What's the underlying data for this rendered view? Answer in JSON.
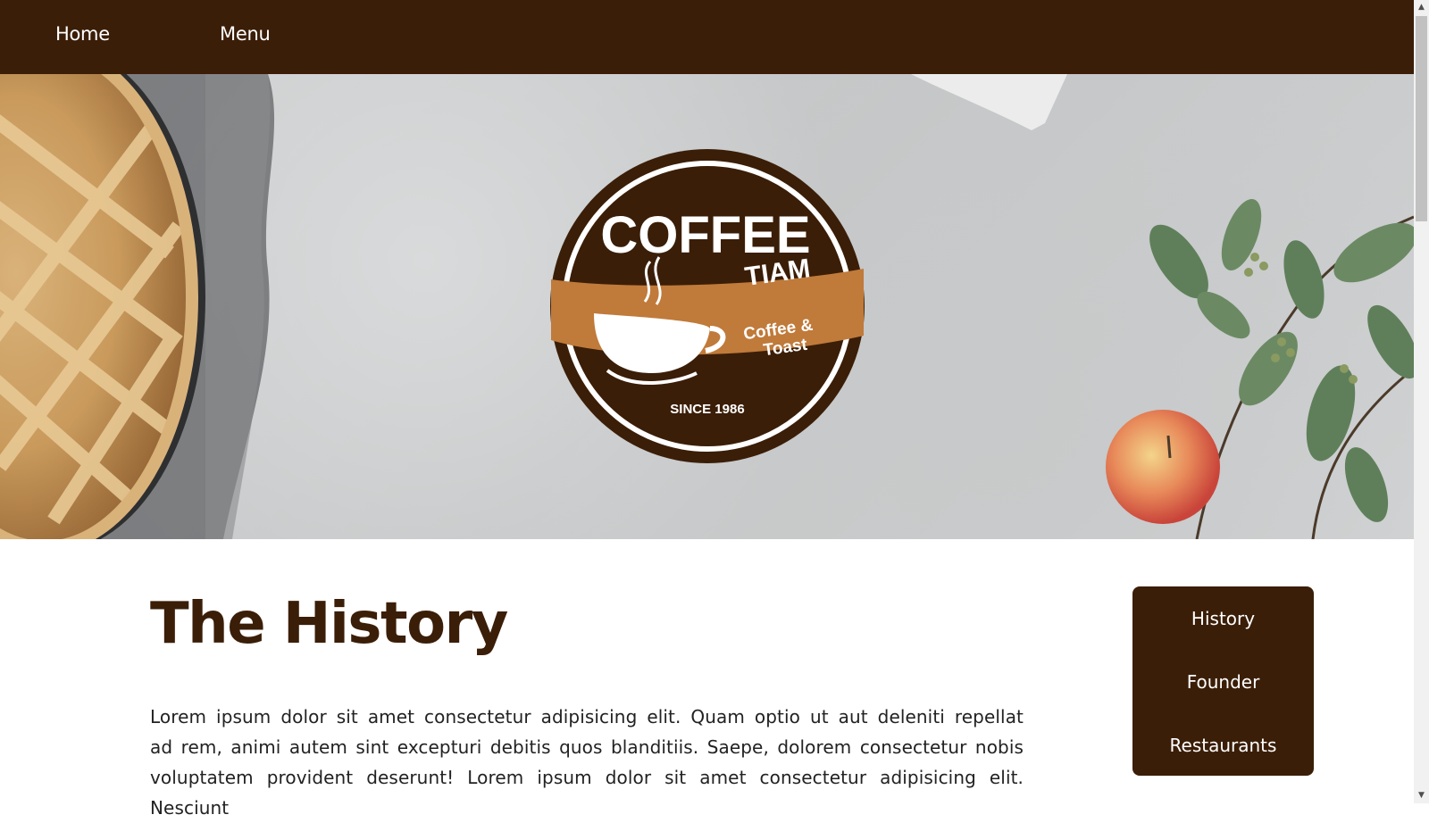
{
  "nav": {
    "items": [
      {
        "label": "Home"
      },
      {
        "label": "Menu"
      }
    ]
  },
  "hero": {
    "logo": {
      "title": "COFFEE",
      "subtitle": "TIAM",
      "band_line1": "Coffee &",
      "band_line2": "Toast",
      "since": "SINCE 1986"
    },
    "colors": {
      "brown": "#3b1e08",
      "orange": "#c07a3a",
      "concrete": "#cbcdce"
    }
  },
  "main": {
    "title": "The History",
    "body": "Lorem ipsum dolor sit amet consectetur adipisicing elit. Quam optio ut aut deleniti repellat ad rem, animi autem sint excepturi debitis quos blanditiis. Saepe, dolorem consectetur nobis voluptatem provident deserunt! Lorem ipsum dolor sit amet consectetur adipisicing elit. Nesciunt"
  },
  "side_menu": {
    "items": [
      {
        "label": "History"
      },
      {
        "label": "Founder"
      },
      {
        "label": "Restaurants"
      }
    ]
  }
}
